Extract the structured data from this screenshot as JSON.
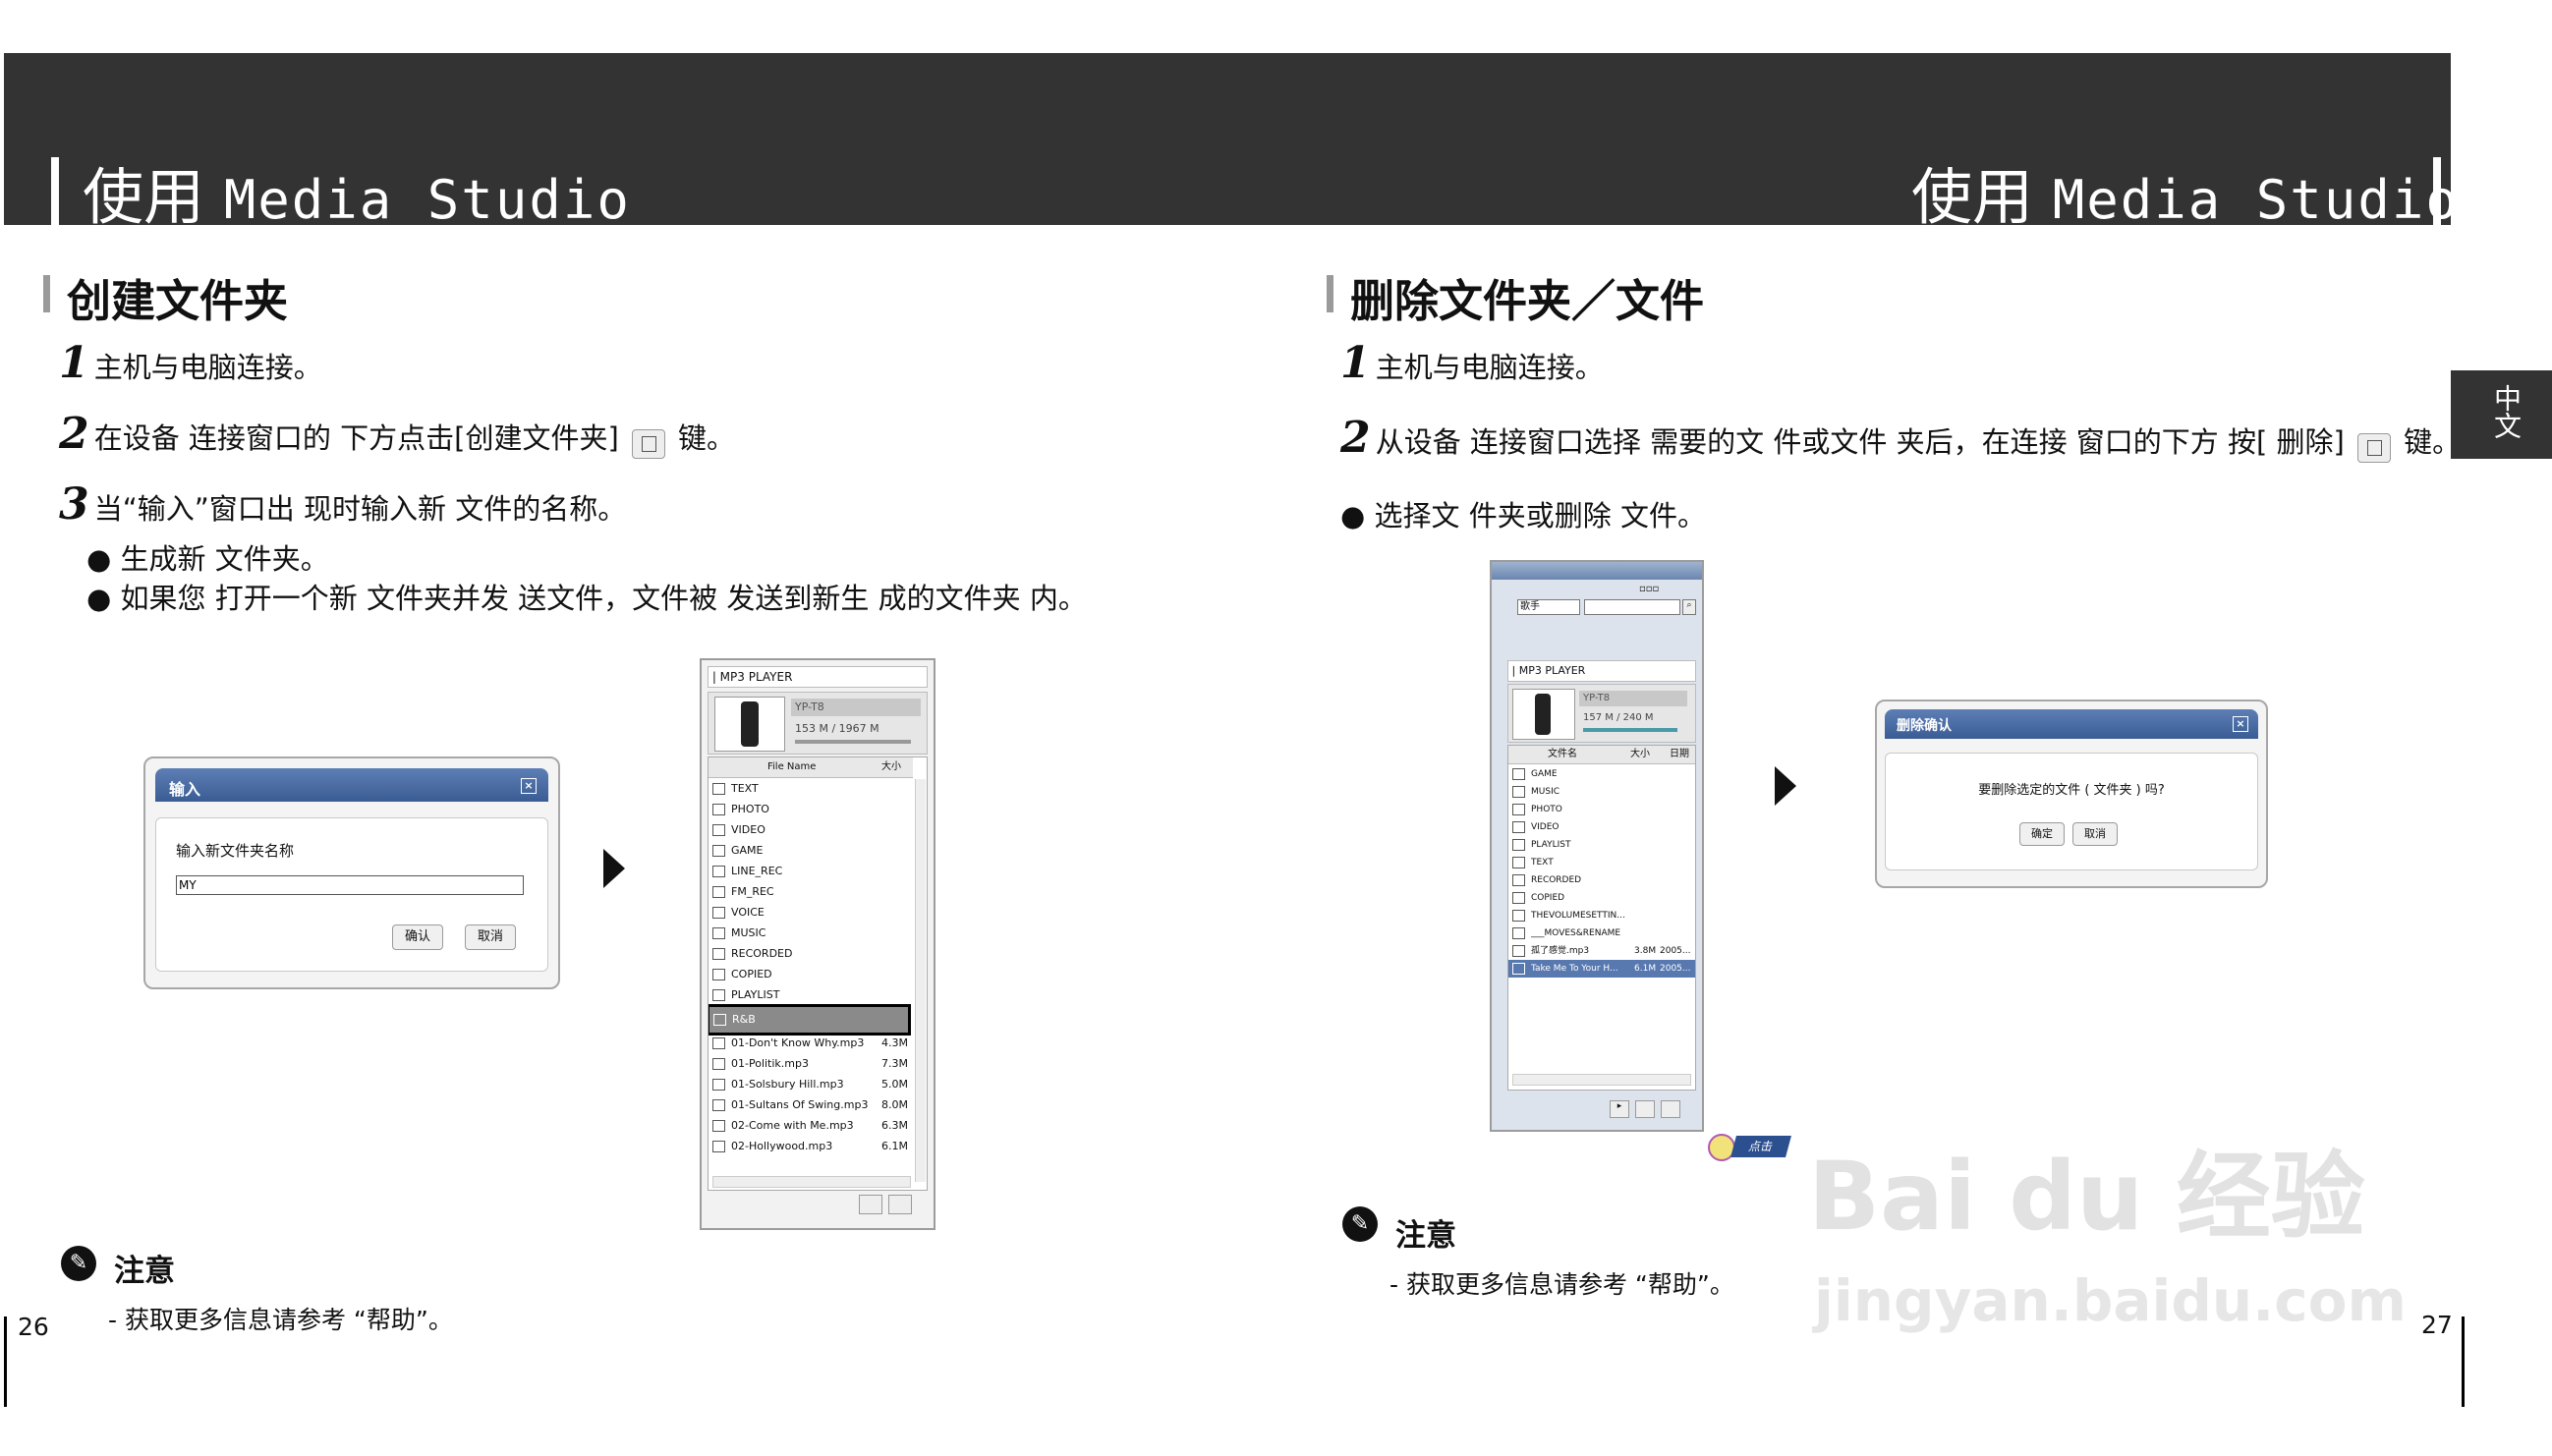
{
  "header": {
    "left_title_cn": "使用",
    "left_title_en": "Media Studio",
    "right_title_cn": "使用",
    "right_title_en": "Media Studio"
  },
  "side_tab": {
    "label": "中文"
  },
  "left": {
    "section_title": "创建文件夹",
    "steps": [
      {
        "num": "1",
        "text": "主机与电脑连接。"
      },
      {
        "num": "2",
        "text_before": "在设备 连接窗口的 下方点击[创建文件夹]",
        "text_after": "键。"
      },
      {
        "num": "3",
        "text": "当“输入”窗口出 现时输入新 文件的名称。"
      }
    ],
    "bullets": [
      "生成新 文件夹。",
      "如果您 打开一个新 文件夹并发 送文件，文件被 发送到新生 成的文件夹 内。"
    ],
    "dialog": {
      "title": "输入",
      "prompt": "输入新文件夹名称",
      "value": "MY",
      "ok": "确认",
      "cancel": "取消"
    },
    "panel": {
      "header": "MP3 PLAYER",
      "device": "YP-T8",
      "capacity": "153 M / 1967 M",
      "col_name": "File Name",
      "col_size": "大小",
      "folders": [
        "TEXT",
        "PHOTO",
        "VIDEO",
        "GAME",
        "LINE_REC",
        "FM_REC",
        "VOICE",
        "MUSIC",
        "RECORDED",
        "COPIED",
        "PLAYLIST"
      ],
      "selected": "R&B",
      "files": [
        {
          "name": "01-Don't Know Why.mp3",
          "size": "4.3M"
        },
        {
          "name": "01-Politik.mp3",
          "size": "7.3M"
        },
        {
          "name": "01-Solsbury Hill.mp3",
          "size": "5.0M"
        },
        {
          "name": "01-Sultans Of Swing.mp3",
          "size": "8.0M"
        },
        {
          "name": "02-Come with Me.mp3",
          "size": "6.3M"
        },
        {
          "name": "02-Hollywood.mp3",
          "size": "6.1M"
        }
      ]
    },
    "note": {
      "title": "注意",
      "text": "- 获取更多信息请参考 “帮助”。"
    },
    "page_number": "26"
  },
  "right": {
    "section_title": "删除文件夹／文件",
    "steps": [
      {
        "num": "1",
        "text": "主机与电脑连接。"
      },
      {
        "num": "2",
        "text_before": "从设备 连接窗口选择 需要的文 件或文件 夹后，在连接 窗口的下方 按[ 删除]",
        "text_after": "键。"
      }
    ],
    "bullets": [
      "选择文 件夹或删除 文件。"
    ],
    "panel": {
      "search_label": "歌手",
      "header": "MP3 PLAYER",
      "device": "YP-T8",
      "capacity": "157 M / 240 M",
      "col_name": "文件名",
      "col_size": "大小",
      "col_date": "日期",
      "folders": [
        "GAME",
        "MUSIC",
        "PHOTO",
        "VIDEO",
        "PLAYLIST",
        "TEXT",
        "RECORDED",
        "COPIED",
        "THEVOLUMESETTIN...",
        "___MOVES&RENAME"
      ],
      "files": [
        {
          "name": "孤了感觉.mp3",
          "size": "3.8M",
          "date": "2005..."
        },
        {
          "name": "Take Me To Your H...",
          "size": "6.1M",
          "date": "2005..."
        }
      ],
      "click_label": "点击"
    },
    "dialog": {
      "title": "删除确认",
      "message": "要删除选定的文件 ( 文件夹 ) 吗?",
      "ok": "确定",
      "cancel": "取消"
    },
    "note": {
      "title": "注意",
      "text": "- 获取更多信息请参考 “帮助”。"
    },
    "page_number": "27"
  },
  "watermark": {
    "brand": "Bai du 经验",
    "url": "jingyan.baidu.com"
  }
}
